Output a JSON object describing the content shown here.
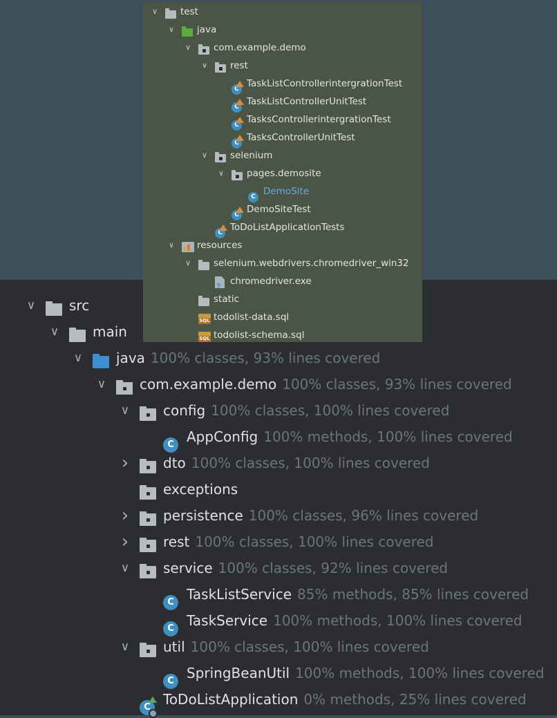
{
  "test_tree": [
    {
      "depth": 0,
      "arrow": "expanded",
      "icon": "folder",
      "label": "test"
    },
    {
      "depth": 1,
      "arrow": "expanded",
      "icon": "source-root",
      "label": "java"
    },
    {
      "depth": 2,
      "arrow": "expanded",
      "icon": "package",
      "label": "com.example.demo"
    },
    {
      "depth": 3,
      "arrow": "expanded",
      "icon": "package",
      "label": "rest"
    },
    {
      "depth": 4,
      "arrow": "none",
      "icon": "test-class",
      "label": "TaskListControllerintergrationTest"
    },
    {
      "depth": 4,
      "arrow": "none",
      "icon": "test-class",
      "label": "TaskListControllerUnitTest"
    },
    {
      "depth": 4,
      "arrow": "none",
      "icon": "test-class",
      "label": "TasksControllerintergrationTest"
    },
    {
      "depth": 4,
      "arrow": "none",
      "icon": "test-class",
      "label": "TasksControllerUnitTest"
    },
    {
      "depth": 3,
      "arrow": "expanded",
      "icon": "package",
      "label": "selenium"
    },
    {
      "depth": 4,
      "arrow": "expanded",
      "icon": "package",
      "label": "pages.demosite"
    },
    {
      "depth": 5,
      "arrow": "none",
      "icon": "class",
      "label": "DemoSite",
      "highlight": true
    },
    {
      "depth": 4,
      "arrow": "none",
      "icon": "test-class",
      "label": "DemoSiteTest"
    },
    {
      "depth": 3,
      "arrow": "none",
      "icon": "test-class",
      "label": "ToDoListApplicationTests"
    },
    {
      "depth": 1,
      "arrow": "expanded",
      "icon": "resources-root",
      "label": "resources"
    },
    {
      "depth": 2,
      "arrow": "expanded",
      "icon": "folder",
      "label": "selenium.webdrivers.chromedriver_win32"
    },
    {
      "depth": 3,
      "arrow": "none",
      "icon": "exe-file",
      "label": "chromedriver.exe"
    },
    {
      "depth": 2,
      "arrow": "none",
      "icon": "folder",
      "label": "static"
    },
    {
      "depth": 2,
      "arrow": "none",
      "icon": "sql-file",
      "label": "todolist-data.sql"
    },
    {
      "depth": 2,
      "arrow": "none",
      "icon": "sql-file",
      "label": "todolist-schema.sql"
    }
  ],
  "main_tree": [
    {
      "depth": 0,
      "arrow": "expanded",
      "icon": "folder",
      "label": "src",
      "coverage": ""
    },
    {
      "depth": 1,
      "arrow": "expanded",
      "icon": "folder",
      "label": "main",
      "coverage": ""
    },
    {
      "depth": 2,
      "arrow": "expanded",
      "icon": "source-root",
      "label": "java",
      "coverage": "100% classes, 93% lines covered"
    },
    {
      "depth": 3,
      "arrow": "expanded",
      "icon": "package",
      "label": "com.example.demo",
      "coverage": "100% classes, 93% lines covered"
    },
    {
      "depth": 4,
      "arrow": "expanded",
      "icon": "package",
      "label": "config",
      "coverage": "100% classes, 100% lines covered"
    },
    {
      "depth": 5,
      "arrow": "none",
      "icon": "class",
      "label": "AppConfig",
      "coverage": "100% methods, 100% lines covered"
    },
    {
      "depth": 4,
      "arrow": "collapsed",
      "icon": "package",
      "label": "dto",
      "coverage": "100% classes, 100% lines covered"
    },
    {
      "depth": 4,
      "arrow": "none",
      "icon": "package",
      "label": "exceptions",
      "coverage": ""
    },
    {
      "depth": 4,
      "arrow": "collapsed",
      "icon": "package",
      "label": "persistence",
      "coverage": "100% classes, 96% lines covered"
    },
    {
      "depth": 4,
      "arrow": "collapsed",
      "icon": "package",
      "label": "rest",
      "coverage": "100% classes, 100% lines covered"
    },
    {
      "depth": 4,
      "arrow": "expanded",
      "icon": "package",
      "label": "service",
      "coverage": "100% classes, 92% lines covered"
    },
    {
      "depth": 5,
      "arrow": "none",
      "icon": "class",
      "label": "TaskListService",
      "coverage": "85% methods, 85% lines covered"
    },
    {
      "depth": 5,
      "arrow": "none",
      "icon": "class",
      "label": "TaskService",
      "coverage": "100% methods, 100% lines covered"
    },
    {
      "depth": 4,
      "arrow": "expanded",
      "icon": "package",
      "label": "util",
      "coverage": "100% classes, 100% lines covered"
    },
    {
      "depth": 5,
      "arrow": "none",
      "icon": "class",
      "label": "SpringBeanUtil",
      "coverage": "100% methods, 100% lines covered"
    },
    {
      "depth": 4,
      "arrow": "none",
      "icon": "spring-app-class",
      "label": "ToDoListApplication",
      "coverage": "0% methods, 25% lines covered"
    }
  ]
}
